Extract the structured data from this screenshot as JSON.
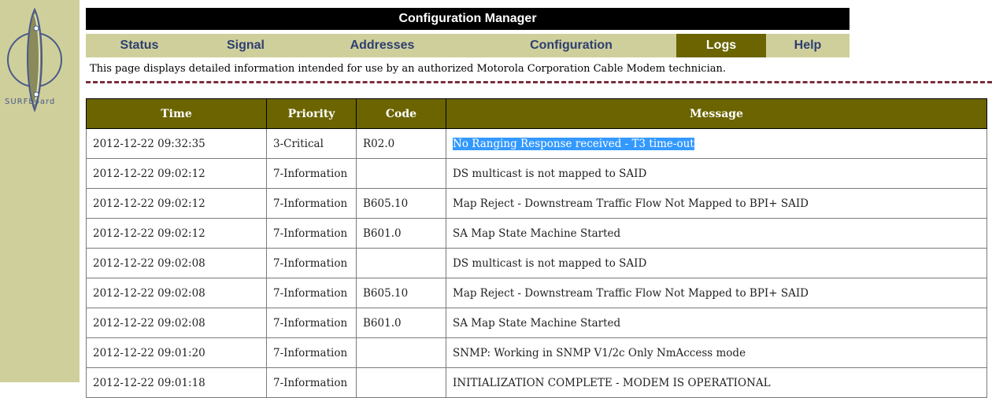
{
  "brand": {
    "logo_text": "SURFboard"
  },
  "header": {
    "title": "Configuration Manager"
  },
  "nav": {
    "items": [
      {
        "label": "Status"
      },
      {
        "label": "Signal"
      },
      {
        "label": "Addresses"
      },
      {
        "label": "Configuration"
      },
      {
        "label": "Logs",
        "active": true
      },
      {
        "label": "Help"
      }
    ]
  },
  "notice": "This page displays detailed information intended for use by an authorized Motorola Corporation Cable Modem technician.",
  "table": {
    "headers": [
      "Time",
      "Priority",
      "Code",
      "Message"
    ],
    "rows": [
      [
        "2012-12-22 09:32:35",
        "3-Critical",
        "R02.0",
        "No Ranging Response received - T3 time-out"
      ],
      [
        "2012-12-22 09:02:12",
        "7-Information",
        "",
        "DS multicast is not mapped to SAID"
      ],
      [
        "2012-12-22 09:02:12",
        "7-Information",
        "B605.10",
        "Map Reject - Downstream Traffic Flow Not Mapped to BPI+ SAID"
      ],
      [
        "2012-12-22 09:02:12",
        "7-Information",
        "B601.0",
        "SA Map State Machine Started"
      ],
      [
        "2012-12-22 09:02:08",
        "7-Information",
        "",
        "DS multicast is not mapped to SAID"
      ],
      [
        "2012-12-22 09:02:08",
        "7-Information",
        "B605.10",
        "Map Reject - Downstream Traffic Flow Not Mapped to BPI+ SAID"
      ],
      [
        "2012-12-22 09:02:08",
        "7-Information",
        "B601.0",
        "SA Map State Machine Started"
      ],
      [
        "2012-12-22 09:01:20",
        "7-Information",
        "",
        "SNMP: Working in SNMP V1/2c Only NmAccess mode"
      ],
      [
        "2012-12-22 09:01:18",
        "7-Information",
        "",
        "INITIALIZATION COMPLETE - MODEM IS OPERATIONAL"
      ]
    ],
    "selected_text": "No Ranging Response received - T3 time-out"
  },
  "colors": {
    "olive": "#6b6400",
    "sidebar": "#cfcf9b",
    "nav_text": "#2e3f70",
    "dashes": "#7a2f3a",
    "selection": "#3399ff"
  }
}
